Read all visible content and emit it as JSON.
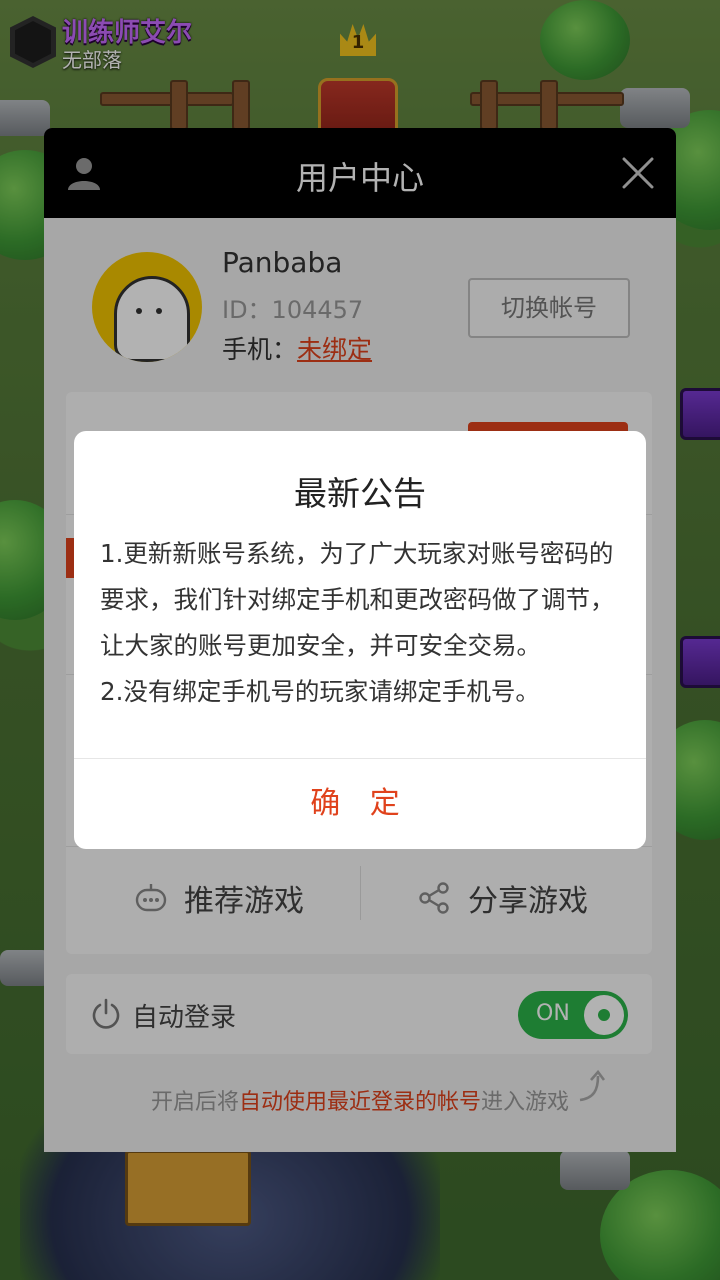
{
  "game": {
    "player_name": "训练师艾尔",
    "clan": "无部落",
    "king_level": "1"
  },
  "user_center": {
    "title": "用户中心",
    "username": "Panbaba",
    "user_id": "ID：104457",
    "phone_label": "手机：",
    "phone_status": "未绑定",
    "switch_account": "切换帐号",
    "recommend_games": "推荐游戏",
    "share_games": "分享游戏",
    "auto_login_label": "自动登录",
    "auto_login_toggle": "ON",
    "auto_login_tip_prefix": "开启后将",
    "auto_login_tip_highlight": "自动使用最近登录的帐号",
    "auto_login_tip_suffix": "进入游戏"
  },
  "dialog": {
    "title": "最新公告",
    "lines": [
      "1.更新新账号系统，为了广大玩家对账号密码的要求，我们针对绑定手机和更改密码做了调节，让大家的账号更加安全，并可安全交易。",
      "2.没有绑定手机号的玩家请绑定手机号。"
    ],
    "confirm": "确 定"
  },
  "icons": {
    "user": "user-icon",
    "close": "close-icon",
    "gamepad": "gamepad-icon",
    "share": "share-icon",
    "power": "power-icon"
  },
  "colors": {
    "accent": "#e0421c",
    "toggle_on": "#2cb34a",
    "header": "#000000"
  }
}
